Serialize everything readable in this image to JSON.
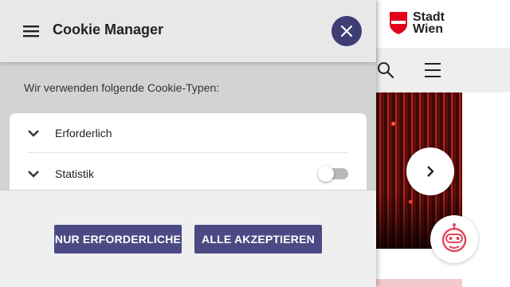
{
  "colors": {
    "accent": "#4b4a84",
    "close_button": "#3e3d74",
    "brand_red": "#e2001a"
  },
  "site": {
    "logo_line1": "Stadt",
    "logo_line2": "Wien",
    "icons": [
      "search-icon",
      "menu-icon",
      "chevron-right-icon",
      "robot-icon"
    ]
  },
  "cookie_manager": {
    "title": "Cookie Manager",
    "intro": "Wir verwenden folgende Cookie-Typen:",
    "categories": [
      {
        "label": "Erforderlich",
        "toggle": null
      },
      {
        "label": "Statistik",
        "toggle": false
      }
    ],
    "buttons": {
      "necessary_only": "NUR ERFORDERLICHE",
      "accept_all": "ALLE AKZEPTIEREN"
    }
  }
}
